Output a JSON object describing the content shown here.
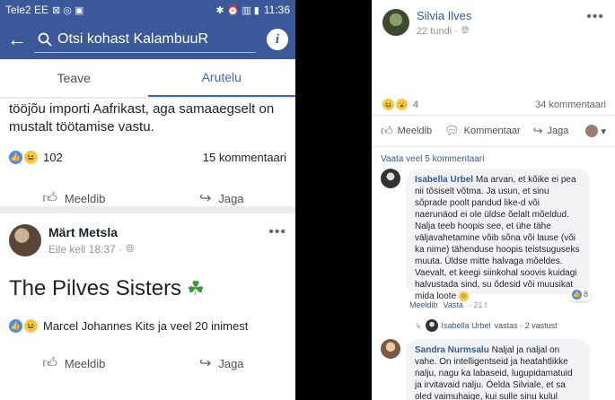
{
  "left": {
    "status": {
      "carrier": "Tele2 EE",
      "time": "11:36"
    },
    "search": {
      "value": "Otsi kohast KalambuuR"
    },
    "tabs": [
      {
        "label": "Teave"
      },
      {
        "label": "Arutelu"
      }
    ],
    "post1": {
      "text": "tööjõu importi Aafrikast, aga samaaegselt on mustalt töötamise vastu.",
      "reactions_count": "102",
      "comments": "15 kommentaari",
      "like_label": "Meeldib",
      "share_label": "Jaga"
    },
    "post2": {
      "author": "Märt Metsla",
      "time": "Eile kell 18:37 ·",
      "text": "The Pilves Sisters",
      "reactions_text": "Marcel Johannes Kits ja veel 20 inimest",
      "like_label": "Meeldib",
      "share_label": "Jaga"
    }
  },
  "right": {
    "post": {
      "author": "Silvia Ilves",
      "time": "22 tundi ·",
      "reactions_count": "4",
      "comments": "34 kommentaari",
      "like_label": "Meeldib",
      "comment_label": "Kommentaar",
      "share_label": "Jaga"
    },
    "view_more": "Vaata veel 5 kommentaari",
    "comment1": {
      "author": "Isabella Urbel",
      "text": "Ma arvan, et kõike ei pea nii tõsiselt võtma. Ja usun, et sinu sõprade poolt pandud like-d või naerunäod ei ole üldse õelalt mõeldud. Nalja teeb hoopis see, et ühe tähe väljavahetamine võib sõna või lause (või ka nime) tähenduse hoopis teistsuguseks muuta. Üldse mitte halvaga mõeldes. Vaevalt, et keegi siinkohal soovis kuidagi halvustada sind, su õdesid või muusikat mida loote",
      "reactions": "8",
      "like": "Meeldib",
      "reply": "Vasta",
      "time": "· 21 t"
    },
    "reply_summary": {
      "name": "Isabella Urbel",
      "text": "vastas · 2 vastust"
    },
    "comment2": {
      "author": "Sandra Nurmsalu",
      "text": "Naljal ja naljal on vahe. On intelligentseid ja heatahtlikke nalju, nagu ka labaseid, lugupidamatuid ja irvitavaid nalju. Öelda Silviale, et sa oled vaimuhaige, kui sulle sinu kulul tehtud"
    }
  }
}
